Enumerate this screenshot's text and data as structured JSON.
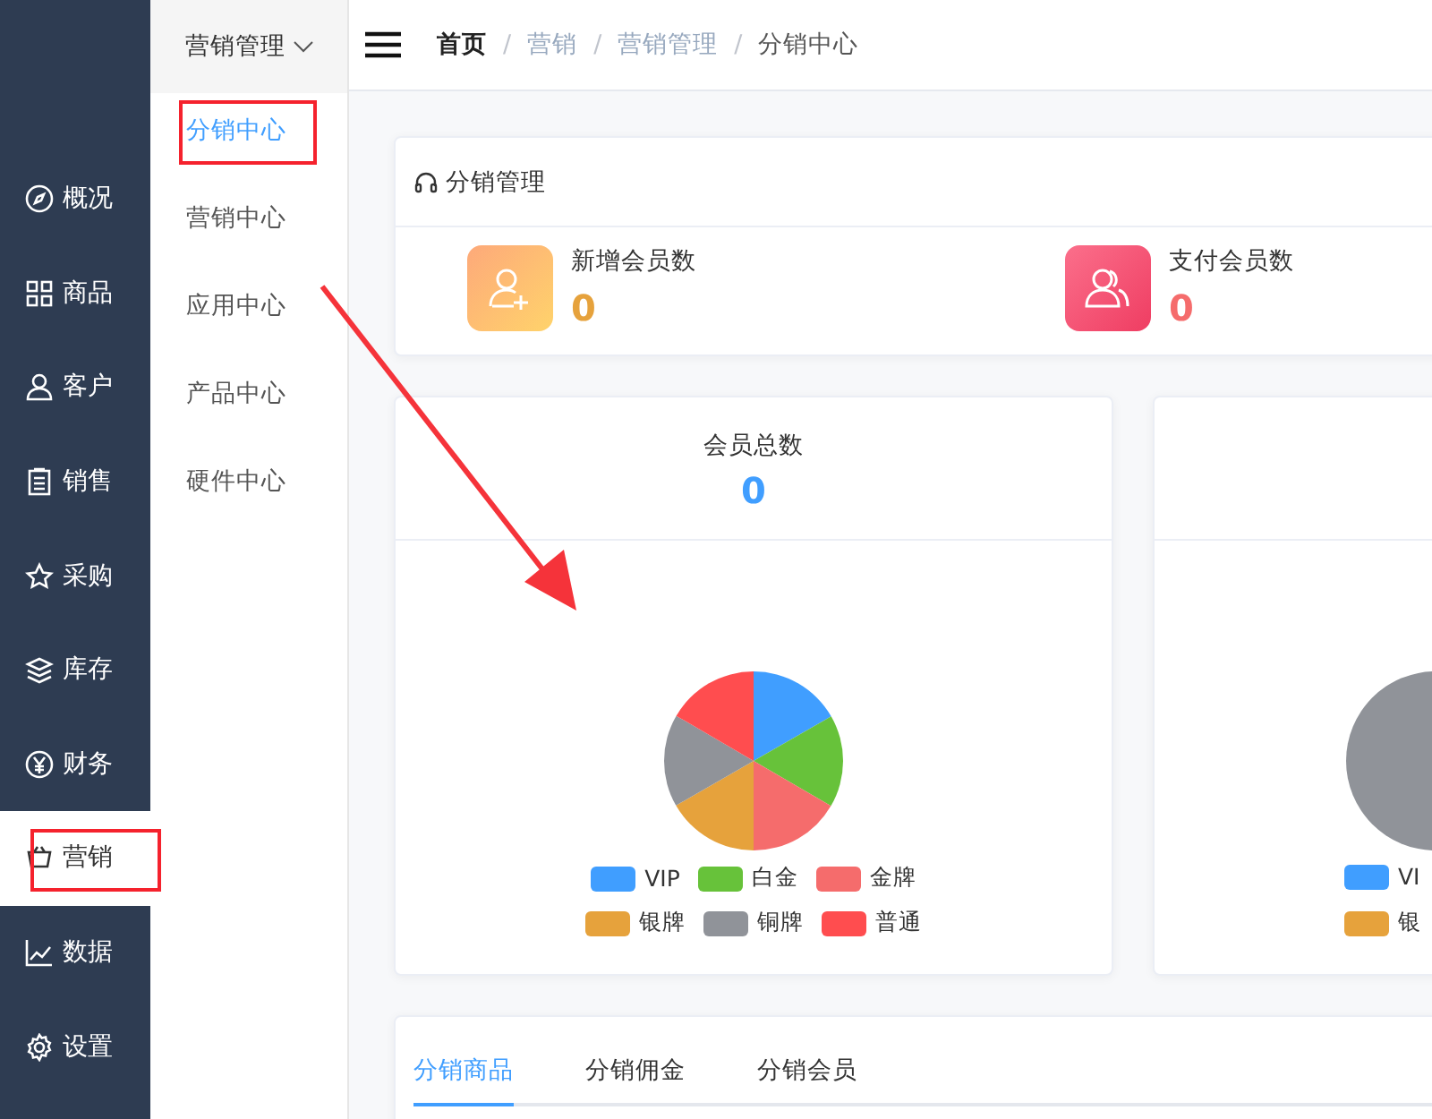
{
  "nav": {
    "items": [
      {
        "label": "概况",
        "selected": false,
        "highlighted": false
      },
      {
        "label": "商品",
        "selected": false,
        "highlighted": false
      },
      {
        "label": "客户",
        "selected": false,
        "highlighted": false
      },
      {
        "label": "销售",
        "selected": false,
        "highlighted": false
      },
      {
        "label": "采购",
        "selected": false,
        "highlighted": false
      },
      {
        "label": "库存",
        "selected": false,
        "highlighted": false
      },
      {
        "label": "财务",
        "selected": false,
        "highlighted": false
      },
      {
        "label": "营销",
        "selected": true,
        "highlighted": true
      },
      {
        "label": "数据",
        "selected": false,
        "highlighted": false
      },
      {
        "label": "设置",
        "selected": false,
        "highlighted": false
      }
    ]
  },
  "submenu": {
    "title": "营销管理",
    "expanded": true,
    "items": [
      {
        "label": "分销中心",
        "selected": true,
        "highlighted": true
      },
      {
        "label": "营销中心",
        "selected": false,
        "highlighted": false
      },
      {
        "label": "应用中心",
        "selected": false,
        "highlighted": false
      },
      {
        "label": "产品中心",
        "selected": false,
        "highlighted": false
      },
      {
        "label": "硬件中心",
        "selected": false,
        "highlighted": false
      }
    ]
  },
  "breadcrumb": [
    {
      "label": "首页",
      "kind": "home"
    },
    {
      "separator": "/",
      "label": "营销",
      "kind": "link"
    },
    {
      "separator": "/",
      "label": "营销管理",
      "kind": "link"
    },
    {
      "separator": "/",
      "label": "分销中心",
      "kind": "current"
    }
  ],
  "summary_card": {
    "title": "分销管理",
    "stats": [
      {
        "label": "新增会员数",
        "value": "0",
        "kind": "new"
      },
      {
        "label": "支付会员数",
        "value": "0",
        "kind": "paid"
      }
    ]
  },
  "member_card": {
    "title": "会员总数",
    "value": "0",
    "chart_data": {
      "type": "pie",
      "categories": [
        "VIP",
        "白金",
        "金牌",
        "银牌",
        "铜牌",
        "普通"
      ],
      "series": [
        {
          "values": [
            16.7,
            16.7,
            16.6,
            16.7,
            16.7,
            16.6
          ]
        }
      ],
      "colors": [
        "#409eff",
        "#67c23a",
        "#f56c6c",
        "#e6a23c",
        "#909399",
        "#ff4d4f"
      ]
    }
  },
  "second_card": {
    "legend": [
      {
        "label": "VI",
        "color": "#409eff"
      },
      {
        "label": "银",
        "color": "#e6a23c"
      }
    ]
  },
  "tabs": [
    {
      "label": "分销商品",
      "selected": true
    },
    {
      "label": "分销佣金",
      "selected": false
    },
    {
      "label": "分销会员",
      "selected": false
    }
  ],
  "annotation_arrow": true
}
